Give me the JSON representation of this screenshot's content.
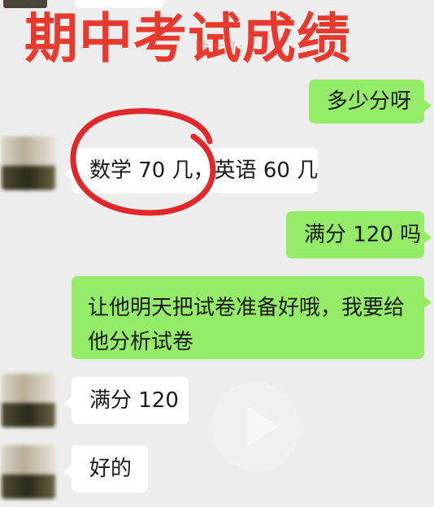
{
  "title_overlay": "期中考试成绩",
  "time_ghost": "晚上7:…",
  "messages": [
    {
      "side": "right",
      "text": "多少分呀"
    },
    {
      "side": "left",
      "text": "数学 70 几，英语 60 几"
    },
    {
      "side": "right",
      "text": "满分 120 吗"
    },
    {
      "side": "right",
      "text": "让他明天把试卷准备好哦，我要给他分析试卷"
    },
    {
      "side": "left",
      "text": "满分 120"
    },
    {
      "side": "left",
      "text": "好的"
    }
  ],
  "colors": {
    "background": "#ededed",
    "sent_bubble": "#95ec69",
    "received_bubble": "#ffffff",
    "title": "#e8392f",
    "annotation_circle": "#e0282a"
  },
  "icons": [
    "play-icon"
  ]
}
